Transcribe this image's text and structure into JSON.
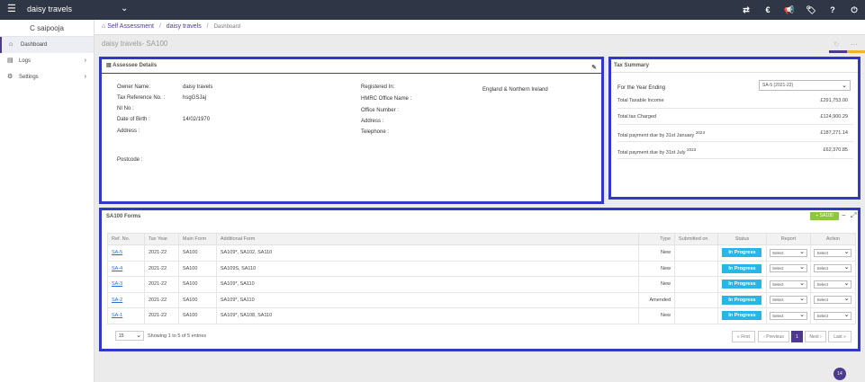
{
  "topbar": {
    "brand": "daisy travels",
    "menu_icon": "☰",
    "caret": "⌄",
    "icons": [
      "⇄",
      "€",
      "📢",
      "🏷",
      "?",
      "⏻"
    ]
  },
  "sidebar": {
    "user": "C saipooja",
    "items": [
      {
        "label": "Dashboard",
        "icon": "⌂",
        "chev": ""
      },
      {
        "label": "Logs",
        "icon": "▤",
        "chev": "›"
      },
      {
        "label": "Settings",
        "icon": "⚙",
        "chev": "›"
      }
    ]
  },
  "breadcrumb": {
    "home_icon": "⌂",
    "items": [
      "Self Assessment",
      "daisy travels",
      "Dashboard"
    ],
    "sep": "/"
  },
  "page": {
    "title": "daisy travels- SA100",
    "refresh_icon": "↻",
    "more_icon": "···"
  },
  "assessee": {
    "title": "Assessee Details",
    "icon": "▤",
    "edit_icon": "✎",
    "left": [
      {
        "label": "Owner Name:",
        "value": "daisy travels"
      },
      {
        "label": "Tax Reference No. :",
        "value": "hsgGSJaj"
      },
      {
        "label": "NI No :",
        "value": ""
      },
      {
        "label": "Date of Birth :",
        "value": "14/02/1970"
      },
      {
        "label": "Address :",
        "value": ""
      },
      {
        "label": "Postcode :",
        "value": ""
      }
    ],
    "right": [
      {
        "label": "Registered In:",
        "value": "England & Northern Ireland"
      },
      {
        "label": "HMRC Office Name :",
        "value": ""
      },
      {
        "label": "Office Number :",
        "value": ""
      },
      {
        "label": "Address :",
        "value": ""
      },
      {
        "label": "Telephone :",
        "value": ""
      }
    ]
  },
  "tax_summary": {
    "title": "Tax Summary",
    "year_label": "For the Year Ending",
    "year_select": "SA-5 (2021-22)",
    "select_arrow": "⌄",
    "rows": [
      {
        "label": "Total Taxable Income",
        "value": "£291,753.00",
        "sup": ""
      },
      {
        "label": "Total tax Charged",
        "value": "£124,900.29",
        "sup": ""
      },
      {
        "label": "Total payment due by 31st January ",
        "value": "£187,271.14",
        "sup": "2023"
      },
      {
        "label": "Total payment due by 31st July ",
        "value": "£62,370.85",
        "sup": "2023"
      }
    ]
  },
  "forms": {
    "title": "SA100 Forms",
    "add_button": "+ SA100",
    "minimize": "−",
    "expand": "⤢",
    "columns": [
      "Ref. No.",
      "Tax Year",
      "Main Form",
      "Additional Form",
      "Type",
      "Submitted on",
      "Status",
      "Report",
      "Action"
    ],
    "rows": [
      {
        "ref": "SA-5",
        "year": "2021-22",
        "main": "SA100",
        "additional": "SA109*, SA102, SA110",
        "type": "New",
        "submitted": "",
        "status": "In Progress",
        "report": "Select",
        "action": "Select"
      },
      {
        "ref": "SA-4",
        "year": "2021-22",
        "main": "SA100",
        "additional": "SA109S, SA110",
        "type": "New",
        "submitted": "",
        "status": "In Progress",
        "report": "Select",
        "action": "Select"
      },
      {
        "ref": "SA-3",
        "year": "2021-22",
        "main": "SA100",
        "additional": "SA109*, SA110",
        "type": "New",
        "submitted": "",
        "status": "In Progress",
        "report": "Select",
        "action": "Select"
      },
      {
        "ref": "SA-2",
        "year": "2021-22",
        "main": "SA100",
        "additional": "SA109*, SA110",
        "type": "Amended",
        "submitted": "",
        "status": "In Progress",
        "report": "Select",
        "action": "Select"
      },
      {
        "ref": "SA-1",
        "year": "2021-22",
        "main": "SA100",
        "additional": "SA109*, SA108, SA110",
        "type": "New",
        "submitted": "",
        "status": "In Progress",
        "report": "Select",
        "action": "Select"
      }
    ],
    "page_size": "15",
    "showing": "Showing 1 to 5 of 5 entries",
    "pager": {
      "first": "« First",
      "previous": "‹ Previous",
      "current": "1",
      "next": "Next ›",
      "last": "Last »"
    }
  },
  "chat_badge": "14",
  "accent_colors": {
    "brand": "#4d3a8c",
    "status": "#29b6e6",
    "add": "#8dc63f",
    "highlight": "#3137c7"
  }
}
